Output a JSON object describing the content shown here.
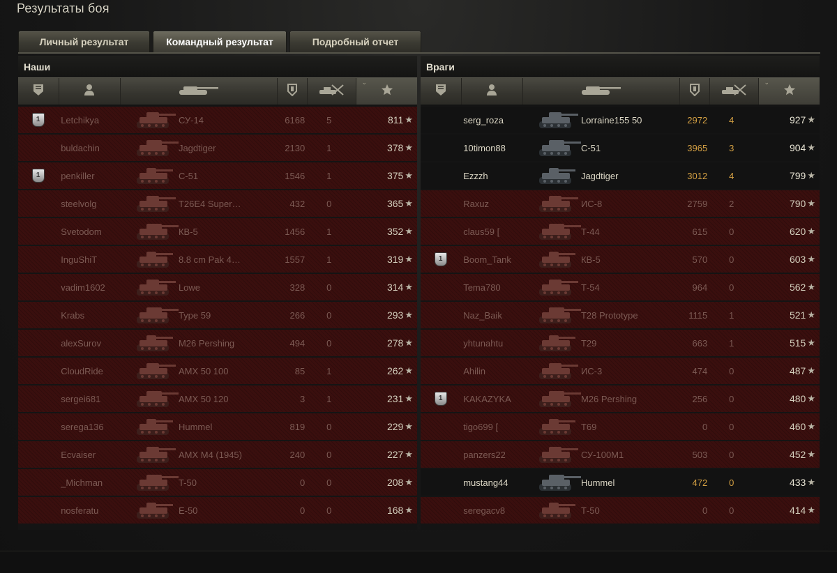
{
  "title": "Результаты боя",
  "tabs": [
    {
      "label": "Личный результат",
      "active": false
    },
    {
      "label": "Командный результат",
      "active": true
    },
    {
      "label": "Подробный отчет",
      "active": false
    }
  ],
  "colors": {
    "dead_row": "#3a0f0e",
    "alive_row": "#121212",
    "alive_stat": "#d4a043"
  },
  "icons": {
    "medal_col": "medal-icon",
    "player_col": "player-icon",
    "tank_col": "tank-icon",
    "damage_col": "damage-icon",
    "kills_col": "kills-icon",
    "xp_col": "star-icon"
  },
  "teams": [
    {
      "title": "Наши",
      "players": [
        {
          "medal": true,
          "name": "Letchikya",
          "tank": "СУ-14",
          "damage": "6168",
          "kills": "5",
          "xp": "811",
          "alive": false
        },
        {
          "medal": false,
          "name": "buldachin",
          "tank": "Jagdtiger",
          "damage": "2130",
          "kills": "1",
          "xp": "378",
          "alive": false
        },
        {
          "medal": true,
          "name": "penkiller",
          "tank": "С-51",
          "damage": "1546",
          "kills": "1",
          "xp": "375",
          "alive": false
        },
        {
          "medal": false,
          "name": "steelvolg",
          "tank": "T26E4 Super…",
          "damage": "432",
          "kills": "0",
          "xp": "365",
          "alive": false
        },
        {
          "medal": false,
          "name": "Svetodom",
          "tank": "КВ-5",
          "damage": "1456",
          "kills": "1",
          "xp": "352",
          "alive": false
        },
        {
          "medal": false,
          "name": "InguShiT",
          "tank": "8.8 cm Pak 4…",
          "damage": "1557",
          "kills": "1",
          "xp": "319",
          "alive": false
        },
        {
          "medal": false,
          "name": "vadim1602",
          "tank": "Lowe",
          "damage": "328",
          "kills": "0",
          "xp": "314",
          "alive": false
        },
        {
          "medal": false,
          "name": "Krabs",
          "tank": "Type 59",
          "damage": "266",
          "kills": "0",
          "xp": "293",
          "alive": false
        },
        {
          "medal": false,
          "name": "alexSurov",
          "tank": "M26 Pershing",
          "damage": "494",
          "kills": "0",
          "xp": "278",
          "alive": false
        },
        {
          "medal": false,
          "name": "CloudRide",
          "tank": "AMX 50 100",
          "damage": "85",
          "kills": "1",
          "xp": "262",
          "alive": false
        },
        {
          "medal": false,
          "name": "sergei681",
          "tank": "AMX 50 120",
          "damage": "3",
          "kills": "1",
          "xp": "231",
          "alive": false
        },
        {
          "medal": false,
          "name": "serega136",
          "tank": "Hummel",
          "damage": "819",
          "kills": "0",
          "xp": "229",
          "alive": false
        },
        {
          "medal": false,
          "name": "Ecvaiser",
          "tank": "AMX M4 (1945)",
          "damage": "240",
          "kills": "0",
          "xp": "227",
          "alive": false
        },
        {
          "medal": false,
          "name": "_Michman",
          "tank": "T-50",
          "damage": "0",
          "kills": "0",
          "xp": "208",
          "alive": false
        },
        {
          "medal": false,
          "name": "nosferatu",
          "tank": "E-50",
          "damage": "0",
          "kills": "0",
          "xp": "168",
          "alive": false
        }
      ]
    },
    {
      "title": "Враги",
      "players": [
        {
          "medal": false,
          "name": "serg_roza",
          "tank": "Lorraine155 50",
          "damage": "2972",
          "kills": "4",
          "xp": "927",
          "alive": true
        },
        {
          "medal": false,
          "name": "10timon88",
          "tank": "С-51",
          "damage": "3965",
          "kills": "3",
          "xp": "904",
          "alive": true
        },
        {
          "medal": false,
          "name": "Ezzzh",
          "tank": "Jagdtiger",
          "damage": "3012",
          "kills": "4",
          "xp": "799",
          "alive": true
        },
        {
          "medal": false,
          "name": "Raxuz",
          "tank": "ИС-8",
          "damage": "2759",
          "kills": "2",
          "xp": "790",
          "alive": false
        },
        {
          "medal": false,
          "name": "claus59 [",
          "tank": "Т-44",
          "damage": "615",
          "kills": "0",
          "xp": "620",
          "alive": false
        },
        {
          "medal": true,
          "name": "Boom_Tank",
          "tank": "КВ-5",
          "damage": "570",
          "kills": "0",
          "xp": "603",
          "alive": false
        },
        {
          "medal": false,
          "name": "Tema780",
          "tank": "Т-54",
          "damage": "964",
          "kills": "0",
          "xp": "562",
          "alive": false
        },
        {
          "medal": false,
          "name": "Naz_Baik",
          "tank": "T28 Prototype",
          "damage": "1115",
          "kills": "1",
          "xp": "521",
          "alive": false
        },
        {
          "medal": false,
          "name": "yhtunahtu",
          "tank": "T29",
          "damage": "663",
          "kills": "1",
          "xp": "515",
          "alive": false
        },
        {
          "medal": false,
          "name": "Ahilin",
          "tank": "ИС-3",
          "damage": "474",
          "kills": "0",
          "xp": "487",
          "alive": false
        },
        {
          "medal": true,
          "name": "KAKAZYKA",
          "tank": "M26 Pershing",
          "damage": "256",
          "kills": "0",
          "xp": "480",
          "alive": false
        },
        {
          "medal": false,
          "name": "tigo699 [",
          "tank": "T69",
          "damage": "0",
          "kills": "0",
          "xp": "460",
          "alive": false
        },
        {
          "medal": false,
          "name": "panzers22",
          "tank": "СУ-100М1",
          "damage": "503",
          "kills": "0",
          "xp": "452",
          "alive": false
        },
        {
          "medal": false,
          "name": "mustang44",
          "tank": "Hummel",
          "damage": "472",
          "kills": "0",
          "xp": "433",
          "alive": true
        },
        {
          "medal": false,
          "name": "seregacv8",
          "tank": "Т-50",
          "damage": "0",
          "kills": "0",
          "xp": "414",
          "alive": false
        }
      ]
    }
  ]
}
